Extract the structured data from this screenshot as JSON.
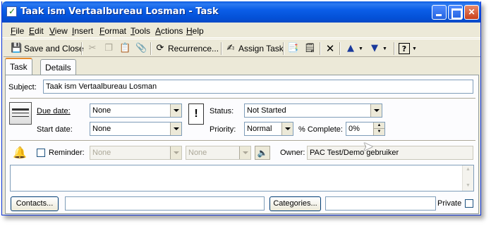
{
  "window": {
    "title": "Taak ism Vertaalbureau Losman - Task"
  },
  "menu": [
    "File",
    "Edit",
    "View",
    "Insert",
    "Format",
    "Tools",
    "Actions",
    "Help"
  ],
  "toolbar": {
    "save_close": "Save and Close",
    "recurrence": "Recurrence...",
    "assign_task": "Assign Task"
  },
  "tabs": [
    "Task",
    "Details"
  ],
  "form": {
    "subject_label": "Subject:",
    "subject_value": "Taak ism Vertaalbureau Losman",
    "due_date_label": "Due date:",
    "due_date_value": "None",
    "start_date_label": "Start date:",
    "start_date_value": "None",
    "status_label": "Status:",
    "status_value": "Not Started",
    "priority_label": "Priority:",
    "priority_value": "Normal",
    "percent_label": "% Complete:",
    "percent_value": "0%",
    "reminder_label": "Reminder:",
    "reminder_date": "None",
    "reminder_time": "None",
    "owner_label": "Owner:",
    "owner_value": "PAC Test/Demo gebruiker",
    "contacts_button": "Contacts...",
    "categories_button": "Categories...",
    "private_label": "Private"
  }
}
